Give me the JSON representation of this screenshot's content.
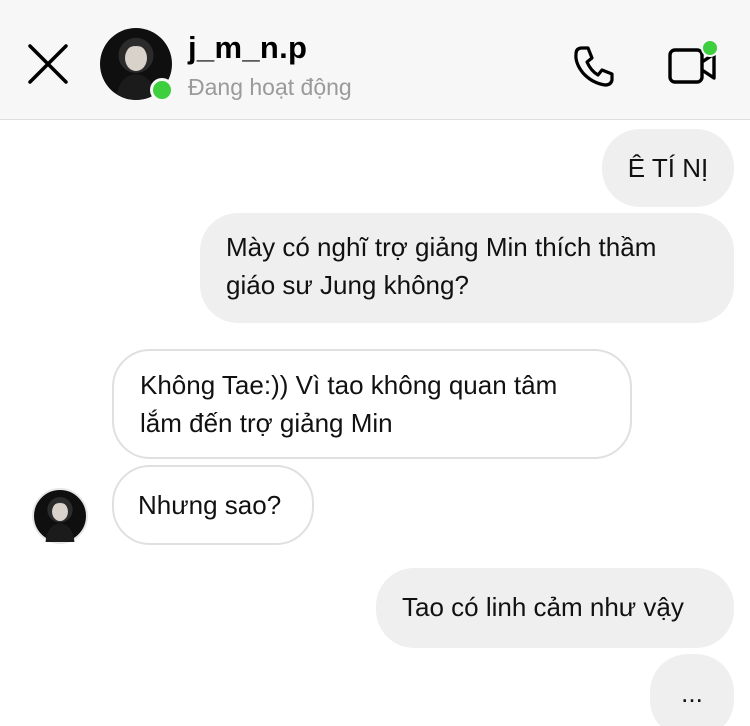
{
  "header": {
    "username": "j_m_n.p",
    "status": "Đang hoạt động",
    "online_color": "#3ecf3e",
    "icons": [
      "close-icon",
      "phone-icon",
      "video-camera-icon"
    ]
  },
  "messages": [
    {
      "side": "out",
      "text": "Ê TÍ NỊ"
    },
    {
      "side": "out",
      "line1": "Mày có nghĩ trợ giảng Min thích thầm",
      "line2": "giáo sư Jung không?"
    },
    {
      "side": "in",
      "line1": "Không Tae:)) Vì tao không quan tâm",
      "line2": "lắm đến trợ giảng Min"
    },
    {
      "side": "in",
      "text": "Nhưng sao?"
    },
    {
      "side": "out",
      "text": "Tao có linh cảm như vậy"
    },
    {
      "side": "out",
      "text": "..."
    }
  ]
}
